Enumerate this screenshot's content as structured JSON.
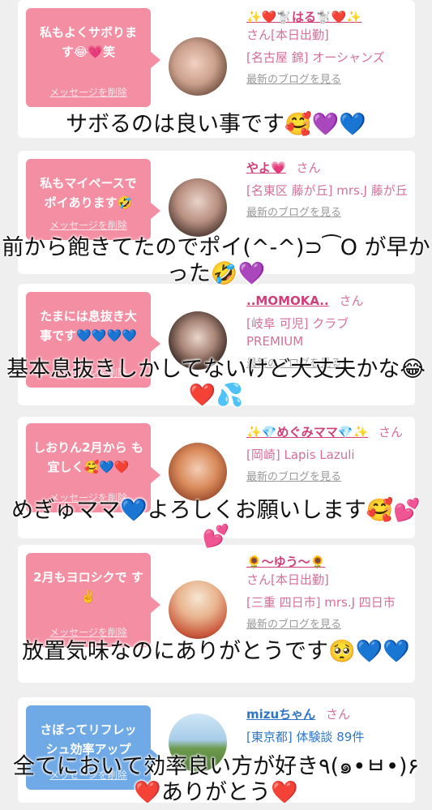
{
  "cards": [
    {
      "message": "私もよくサボりますΟ笑",
      "message_display": "私もよくサボりま す😂💗笑",
      "delete_label": "メッセージを削除",
      "name": "✨❤️🐩はる🐩❤️✨",
      "honorific": "さん[本日出勤]",
      "shop": "[名古屋 錦] オーシャンズ",
      "blog": "最新のブログを見る",
      "caption": "サボるのは良い事です🥰💜💙"
    },
    {
      "message_display": "私もマイペースで ポイあります🤣",
      "delete_label": "メッセージを削除",
      "name": "やよ💗",
      "honorific": "さん",
      "shop": "[名東区 藤が丘] mrs.J 藤が丘",
      "blog": "最新のブログを見る",
      "caption": "前から飽きてたのでポイ(^-^)⊃⁀O が早かった🤣💜"
    },
    {
      "message_display": "たまには息抜き大 事です💙💙💙💙",
      "delete_label": "メッセージを削除",
      "name": "..MOMOKA..",
      "honorific": "さん",
      "shop": "[岐阜 可児] クラブ PREMIUM",
      "blog": "最新のブログを見る",
      "caption": "基本息抜きしかしてないけど大丈夫かな😂❤️💦"
    },
    {
      "message_display": "しおりん2月から も宜しく🥰💙❤️",
      "delete_label": "メッセージを削除",
      "name": "✨💎めぐみママ💎✨",
      "honorific": "さん",
      "shop": "[岡崎] Lapis Lazuli",
      "blog": "最新のブログを見る",
      "caption": "めぎゅママ💙よろしくお願いします🥰💕💕"
    },
    {
      "message_display": "2月もヨロシクで す✌️",
      "delete_label": "メッセージを削除",
      "name": "🌻〜ゆう〜🌻",
      "honorific": "さん[本日出勤]",
      "shop": "[三重 四日市] mrs.J 四日市",
      "blog": "最新のブログを見る",
      "caption": "放置気味なのにありがとうです🥺💙💙"
    },
    {
      "message_display": "さぼってリフレッ シュ効率アップ",
      "delete_label": "メッセージを削除",
      "name": "mizuちゃん",
      "honorific": "さん",
      "shop": "[東京都] 体験談 89件",
      "blog": "",
      "caption": "全てにおいて効率良い方が好き٩(๑•ㅂ•)۶❤️ありがとう❤️"
    }
  ],
  "colors": {
    "pink_bubble": "#f48fa3",
    "blue_bubble": "#6fa9e6",
    "name_pink": "#d13f7a",
    "name_blue": "#2e75c8"
  }
}
